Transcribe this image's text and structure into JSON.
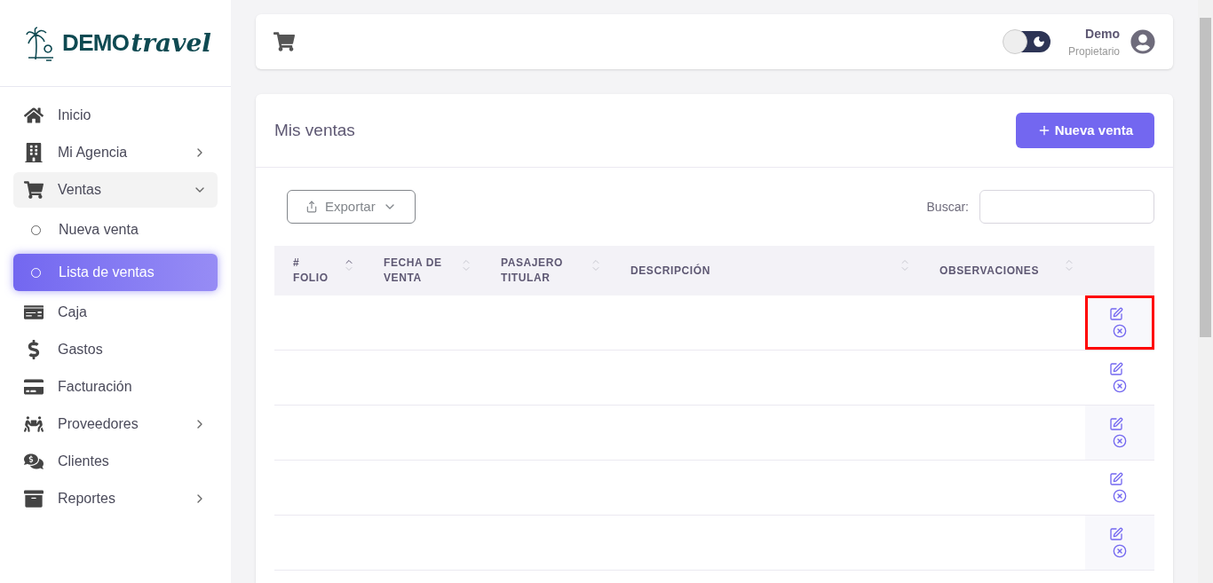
{
  "logo": {
    "brand": "DEMO",
    "tagline": "travel"
  },
  "sidebar": {
    "items": [
      {
        "label": "Inicio",
        "expandable": false,
        "expanded": false
      },
      {
        "label": "Mi Agencia",
        "expandable": true,
        "expanded": false
      },
      {
        "label": "Ventas",
        "expandable": true,
        "expanded": true,
        "children": [
          {
            "label": "Nueva venta",
            "selected": false
          },
          {
            "label": "Lista de ventas",
            "selected": true
          }
        ]
      },
      {
        "label": "Caja",
        "expandable": false,
        "expanded": false
      },
      {
        "label": "Gastos",
        "expandable": false,
        "expanded": false
      },
      {
        "label": "Facturación",
        "expandable": false,
        "expanded": false
      },
      {
        "label": "Proveedores",
        "expandable": true,
        "expanded": false
      },
      {
        "label": "Clientes",
        "expandable": false,
        "expanded": false
      },
      {
        "label": "Reportes",
        "expandable": true,
        "expanded": false
      }
    ]
  },
  "header": {
    "theme_toggle": {
      "on": false
    },
    "user": {
      "name": "Demo",
      "role": "Propietario"
    }
  },
  "page": {
    "title": "Mis ventas",
    "new_button": "Nueva venta",
    "export_button": "Exportar",
    "search_label": "Buscar:"
  },
  "table": {
    "columns": [
      {
        "label": "# FOLIO",
        "sorted": true
      },
      {
        "label": "FECHA DE VENTA",
        "sorted": false
      },
      {
        "label": "PASAJERO TITULAR",
        "sorted": false
      },
      {
        "label": "DESCRIPCIÓN",
        "sorted": false
      },
      {
        "label": "OBSERVACIONES",
        "sorted": false
      }
    ],
    "rows": [
      {
        "highlighted": true
      },
      {
        "highlighted": false
      },
      {
        "highlighted": false
      },
      {
        "highlighted": false
      },
      {
        "highlighted": false
      }
    ]
  }
}
